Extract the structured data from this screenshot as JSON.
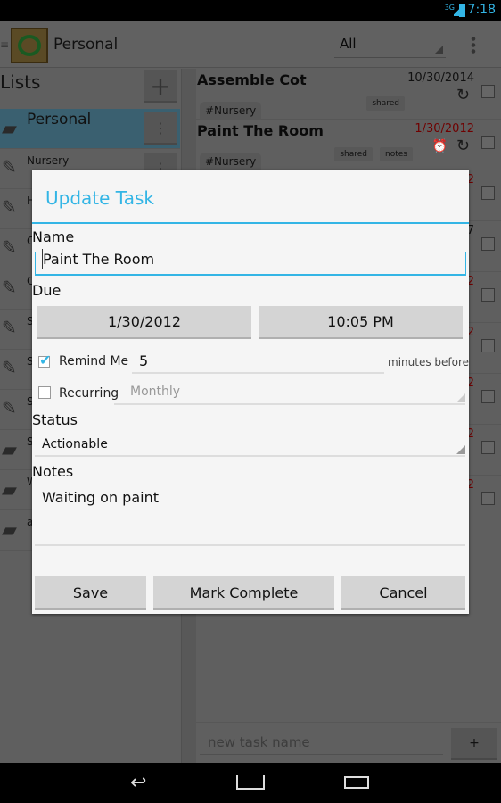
{
  "status_bar": {
    "network": "3G",
    "time": "7:18"
  },
  "action_bar": {
    "title": "Personal",
    "filter": "All"
  },
  "sidebar": {
    "heading": "Lists",
    "items": [
      {
        "label": "Personal",
        "icon": "folder-icon",
        "selected": true
      },
      {
        "label": "Nursery",
        "icon": "pencil-icon"
      },
      {
        "label": "H",
        "icon": "pencil-icon"
      },
      {
        "label": "C",
        "icon": "pencil-icon"
      },
      {
        "label": "C",
        "icon": "pencil-icon"
      },
      {
        "label": "S",
        "icon": "pencil-icon"
      },
      {
        "label": "S",
        "icon": "pencil-icon"
      },
      {
        "label": "S",
        "icon": "pencil-icon"
      },
      {
        "label": "S",
        "icon": "folder-icon"
      },
      {
        "label": "W",
        "icon": "folder-icon"
      },
      {
        "label": "a",
        "icon": "folder-icon"
      }
    ]
  },
  "tasks": [
    {
      "title": "Assemble Cot",
      "date": "10/30/2014",
      "tag": "#Nursery",
      "badges": [
        "shared"
      ]
    },
    {
      "title": "Paint The Room",
      "date": "1/30/2012",
      "tag": "#Nursery",
      "badges": [
        "shared",
        "notes"
      ]
    }
  ],
  "task_fragments": [
    "2",
    "7",
    "2",
    "2",
    "2",
    "2",
    "2"
  ],
  "new_task": {
    "placeholder": "new task name",
    "add": "+"
  },
  "dialog": {
    "title": "Update Task",
    "name_label": "Name",
    "name_value": "Paint The Room",
    "due_label": "Due",
    "due_date": "1/30/2012",
    "due_time": "10:05 PM",
    "remind_label": "Remind Me",
    "remind_checked": true,
    "remind_value": "5",
    "remind_suffix": "minutes before",
    "recurring_label": "Recurring",
    "recurring_checked": false,
    "recurring_value": "Monthly",
    "status_label": "Status",
    "status_value": "Actionable",
    "notes_label": "Notes",
    "notes_value": "Waiting on paint",
    "save": "Save",
    "mark_complete": "Mark Complete",
    "cancel": "Cancel"
  },
  "colors": {
    "accent": "#33b5e5",
    "overdue": "#cc0000"
  }
}
